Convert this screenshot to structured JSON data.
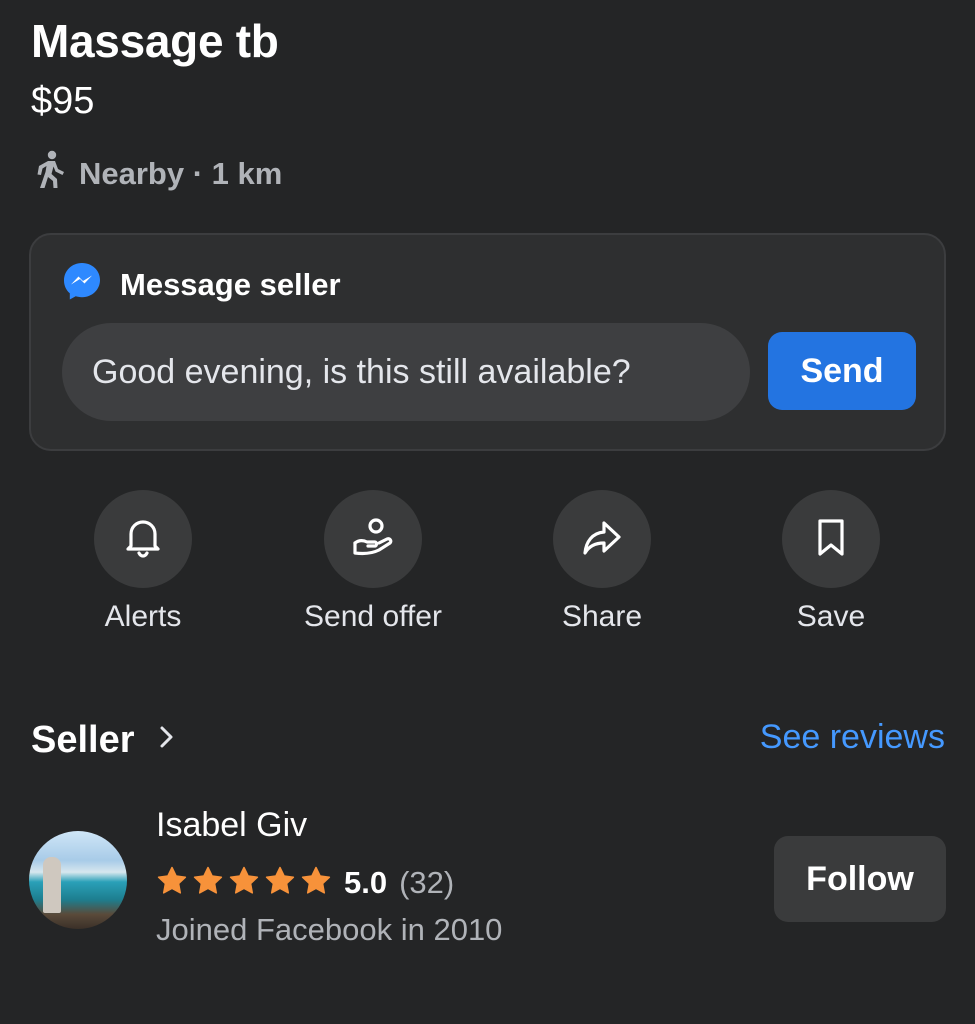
{
  "listing": {
    "title": "Massage tb",
    "price": "$95",
    "location": "Nearby · 1 km",
    "location_icon": "walking-person-icon"
  },
  "message_card": {
    "header": "Message seller",
    "header_icon": "messenger-icon",
    "input_value": "Good evening, is this still available?",
    "send_label": "Send",
    "send_color": "#2374e1"
  },
  "actions": [
    {
      "label": "Alerts",
      "icon": "bell-icon"
    },
    {
      "label": "Send offer",
      "icon": "offer-hand-icon"
    },
    {
      "label": "Share",
      "icon": "share-arrow-icon"
    },
    {
      "label": "Save",
      "icon": "bookmark-icon"
    }
  ],
  "seller_section": {
    "title": "Seller",
    "see_reviews": "See reviews",
    "link_color": "#4599ff"
  },
  "seller": {
    "name": "Isabel Giv",
    "rating_stars": 5,
    "rating_score": "5.0",
    "rating_count": "(32)",
    "joined": "Joined Facebook in 2010",
    "follow_label": "Follow",
    "star_color": "#f7923a"
  }
}
